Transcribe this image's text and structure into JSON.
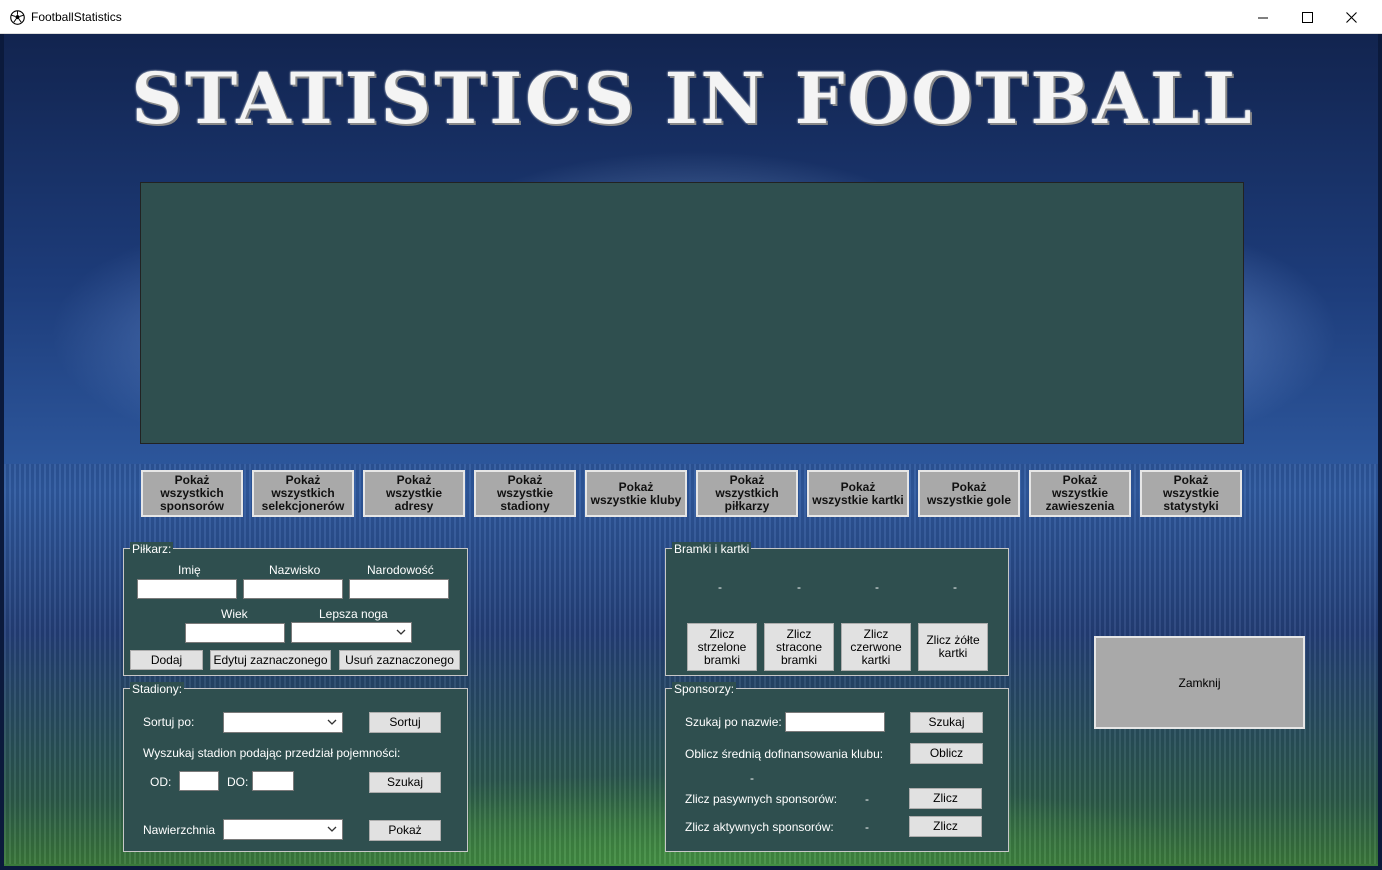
{
  "window": {
    "title": "FootballStatistics"
  },
  "banner": {
    "text": "STATISTICS IN FOOTBALL"
  },
  "show_buttons": [
    "Pokaż wszystkich sponsorów",
    "Pokaż wszystkich selekcjonerów",
    "Pokaż wszystkie adresy",
    "Pokaż wszystkie stadiony",
    "Pokaż wszystkie kluby",
    "Pokaż wszystkich piłkarzy",
    "Pokaż wszystkie kartki",
    "Pokaż wszystkie gole",
    "Pokaż wszystkie zawieszenia",
    "Pokaż wszystkie statystyki"
  ],
  "pilkarz": {
    "legend": "Piłkarz:",
    "imie_label": "Imię",
    "nazwisko_label": "Nazwisko",
    "narodowosc_label": "Narodowość",
    "wiek_label": "Wiek",
    "lepsza_noga_label": "Lepsza noga",
    "imie_value": "",
    "nazwisko_value": "",
    "narodowosc_value": "",
    "wiek_value": "",
    "lepsza_noga_value": "",
    "add_button": "Dodaj",
    "edit_button": "Edytuj zaznaczonego",
    "delete_button": "Usuń zaznaczonego"
  },
  "stadiony": {
    "legend": "Stadiony:",
    "sort_label": "Sortuj po:",
    "sort_value": "",
    "sort_button": "Sortuj",
    "search_capacity_label": "Wyszukaj stadion podając przedział pojemności:",
    "od_label": "OD:",
    "do_label": "DO:",
    "od_value": "",
    "do_value": "",
    "search_button": "Szukaj",
    "surface_label": "Nawierzchnia",
    "surface_value": "",
    "show_button": "Pokaż"
  },
  "bramki": {
    "legend": "Bramki i kartki",
    "results": [
      "-",
      "-",
      "-",
      "-"
    ],
    "buttons": [
      "Zlicz strzelone bramki",
      "Zlicz stracone bramki",
      "Zlicz czerwone kartki",
      "Zlicz żółte kartki"
    ]
  },
  "sponsorzy": {
    "legend": "Sponsorzy:",
    "search_label": "Szukaj po nazwie:",
    "search_value": "",
    "search_button": "Szukaj",
    "avg_label": "Oblicz średnią dofinansowania klubu:",
    "avg_button": "Oblicz",
    "avg_result": "-",
    "passive_label": "Zlicz pasywnych sponsorów:",
    "passive_result": "-",
    "passive_button": "Zlicz",
    "active_label": "Zlicz aktywnych sponsorów:",
    "active_result": "-",
    "active_button": "Zlicz"
  },
  "close_button": "Zamknij"
}
